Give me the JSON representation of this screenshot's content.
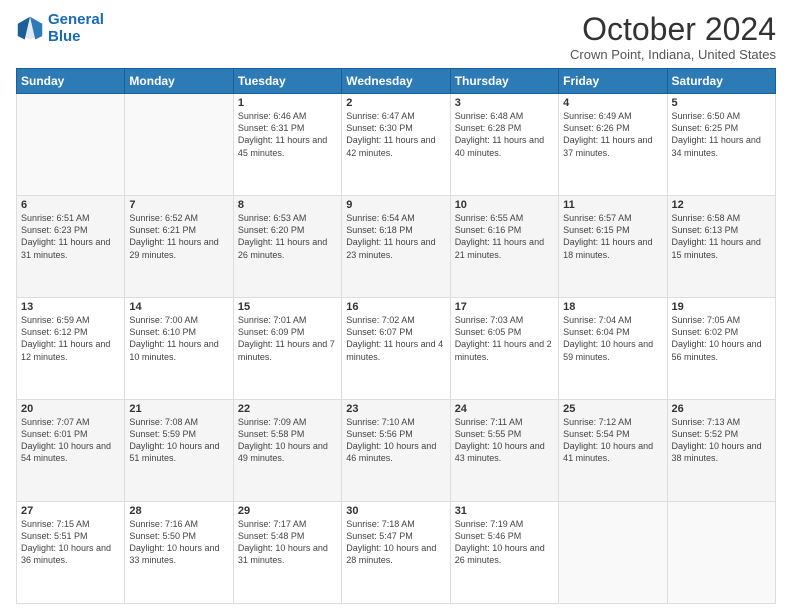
{
  "header": {
    "logo_line1": "General",
    "logo_line2": "Blue",
    "month": "October 2024",
    "location": "Crown Point, Indiana, United States"
  },
  "days_of_week": [
    "Sunday",
    "Monday",
    "Tuesday",
    "Wednesday",
    "Thursday",
    "Friday",
    "Saturday"
  ],
  "weeks": [
    [
      {
        "num": "",
        "info": ""
      },
      {
        "num": "",
        "info": ""
      },
      {
        "num": "1",
        "info": "Sunrise: 6:46 AM\nSunset: 6:31 PM\nDaylight: 11 hours and 45 minutes."
      },
      {
        "num": "2",
        "info": "Sunrise: 6:47 AM\nSunset: 6:30 PM\nDaylight: 11 hours and 42 minutes."
      },
      {
        "num": "3",
        "info": "Sunrise: 6:48 AM\nSunset: 6:28 PM\nDaylight: 11 hours and 40 minutes."
      },
      {
        "num": "4",
        "info": "Sunrise: 6:49 AM\nSunset: 6:26 PM\nDaylight: 11 hours and 37 minutes."
      },
      {
        "num": "5",
        "info": "Sunrise: 6:50 AM\nSunset: 6:25 PM\nDaylight: 11 hours and 34 minutes."
      }
    ],
    [
      {
        "num": "6",
        "info": "Sunrise: 6:51 AM\nSunset: 6:23 PM\nDaylight: 11 hours and 31 minutes."
      },
      {
        "num": "7",
        "info": "Sunrise: 6:52 AM\nSunset: 6:21 PM\nDaylight: 11 hours and 29 minutes."
      },
      {
        "num": "8",
        "info": "Sunrise: 6:53 AM\nSunset: 6:20 PM\nDaylight: 11 hours and 26 minutes."
      },
      {
        "num": "9",
        "info": "Sunrise: 6:54 AM\nSunset: 6:18 PM\nDaylight: 11 hours and 23 minutes."
      },
      {
        "num": "10",
        "info": "Sunrise: 6:55 AM\nSunset: 6:16 PM\nDaylight: 11 hours and 21 minutes."
      },
      {
        "num": "11",
        "info": "Sunrise: 6:57 AM\nSunset: 6:15 PM\nDaylight: 11 hours and 18 minutes."
      },
      {
        "num": "12",
        "info": "Sunrise: 6:58 AM\nSunset: 6:13 PM\nDaylight: 11 hours and 15 minutes."
      }
    ],
    [
      {
        "num": "13",
        "info": "Sunrise: 6:59 AM\nSunset: 6:12 PM\nDaylight: 11 hours and 12 minutes."
      },
      {
        "num": "14",
        "info": "Sunrise: 7:00 AM\nSunset: 6:10 PM\nDaylight: 11 hours and 10 minutes."
      },
      {
        "num": "15",
        "info": "Sunrise: 7:01 AM\nSunset: 6:09 PM\nDaylight: 11 hours and 7 minutes."
      },
      {
        "num": "16",
        "info": "Sunrise: 7:02 AM\nSunset: 6:07 PM\nDaylight: 11 hours and 4 minutes."
      },
      {
        "num": "17",
        "info": "Sunrise: 7:03 AM\nSunset: 6:05 PM\nDaylight: 11 hours and 2 minutes."
      },
      {
        "num": "18",
        "info": "Sunrise: 7:04 AM\nSunset: 6:04 PM\nDaylight: 10 hours and 59 minutes."
      },
      {
        "num": "19",
        "info": "Sunrise: 7:05 AM\nSunset: 6:02 PM\nDaylight: 10 hours and 56 minutes."
      }
    ],
    [
      {
        "num": "20",
        "info": "Sunrise: 7:07 AM\nSunset: 6:01 PM\nDaylight: 10 hours and 54 minutes."
      },
      {
        "num": "21",
        "info": "Sunrise: 7:08 AM\nSunset: 5:59 PM\nDaylight: 10 hours and 51 minutes."
      },
      {
        "num": "22",
        "info": "Sunrise: 7:09 AM\nSunset: 5:58 PM\nDaylight: 10 hours and 49 minutes."
      },
      {
        "num": "23",
        "info": "Sunrise: 7:10 AM\nSunset: 5:56 PM\nDaylight: 10 hours and 46 minutes."
      },
      {
        "num": "24",
        "info": "Sunrise: 7:11 AM\nSunset: 5:55 PM\nDaylight: 10 hours and 43 minutes."
      },
      {
        "num": "25",
        "info": "Sunrise: 7:12 AM\nSunset: 5:54 PM\nDaylight: 10 hours and 41 minutes."
      },
      {
        "num": "26",
        "info": "Sunrise: 7:13 AM\nSunset: 5:52 PM\nDaylight: 10 hours and 38 minutes."
      }
    ],
    [
      {
        "num": "27",
        "info": "Sunrise: 7:15 AM\nSunset: 5:51 PM\nDaylight: 10 hours and 36 minutes."
      },
      {
        "num": "28",
        "info": "Sunrise: 7:16 AM\nSunset: 5:50 PM\nDaylight: 10 hours and 33 minutes."
      },
      {
        "num": "29",
        "info": "Sunrise: 7:17 AM\nSunset: 5:48 PM\nDaylight: 10 hours and 31 minutes."
      },
      {
        "num": "30",
        "info": "Sunrise: 7:18 AM\nSunset: 5:47 PM\nDaylight: 10 hours and 28 minutes."
      },
      {
        "num": "31",
        "info": "Sunrise: 7:19 AM\nSunset: 5:46 PM\nDaylight: 10 hours and 26 minutes."
      },
      {
        "num": "",
        "info": ""
      },
      {
        "num": "",
        "info": ""
      }
    ]
  ]
}
